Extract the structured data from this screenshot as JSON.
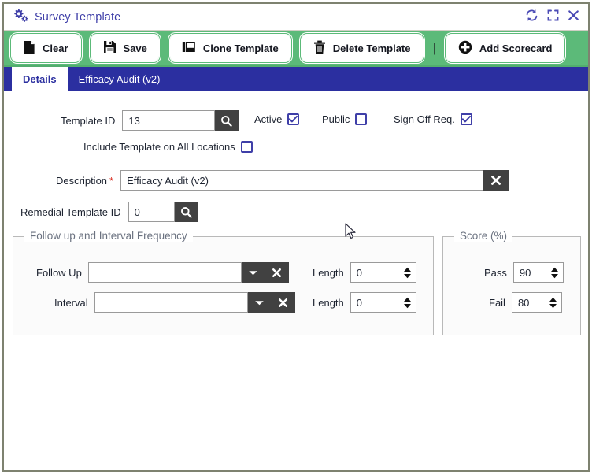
{
  "window": {
    "title": "Survey Template",
    "title_icon": "gears-icon",
    "controls": [
      {
        "name": "refresh-icon",
        "label": "Refresh"
      },
      {
        "name": "maximize-icon",
        "label": "Maximize"
      },
      {
        "name": "close-icon",
        "label": "Close"
      }
    ]
  },
  "toolbar": {
    "buttons": [
      {
        "name": "clear-button",
        "label": "Clear",
        "icon": "file-icon"
      },
      {
        "name": "save-button",
        "label": "Save",
        "icon": "floppy-disk-icon"
      },
      {
        "name": "clone-template-button",
        "label": "Clone Template",
        "icon": "copy-icon"
      },
      {
        "name": "delete-template-button",
        "label": "Delete Template",
        "icon": "trash-icon"
      }
    ],
    "separator": "|",
    "add_scorecard": {
      "name": "add-scorecard-button",
      "label": "Add Scorecard",
      "icon": "plus-circle-icon"
    }
  },
  "tabs": [
    {
      "label": "Details",
      "active": true
    },
    {
      "label": "Efficacy Audit (v2)",
      "active": false
    }
  ],
  "form": {
    "template_id": {
      "label": "Template ID",
      "value": "13",
      "search_icon": "search-icon"
    },
    "active": {
      "label": "Active",
      "checked": true
    },
    "public": {
      "label": "Public",
      "checked": false
    },
    "sign_off_req": {
      "label": "Sign Off Req.",
      "checked": true
    },
    "include_all_locations": {
      "label": "Include Template on All Locations",
      "checked": false
    },
    "description": {
      "label": "Description",
      "required_marker": "*",
      "value": "Efficacy Audit (v2)",
      "clear_icon": "close-x-icon"
    },
    "remedial_template_id": {
      "label": "Remedial Template ID",
      "value": "0",
      "search_icon": "search-icon"
    }
  },
  "follow_up_group": {
    "legend": "Follow up and Interval Frequency",
    "rows": [
      {
        "label": "Follow Up",
        "value": "",
        "placeholder": "",
        "length_label": "Length",
        "length_value": "0"
      },
      {
        "label": "Interval",
        "value": "",
        "placeholder": "",
        "length_label": "Length",
        "length_value": "0"
      }
    ]
  },
  "score_group": {
    "legend": "Score (%)",
    "pass": {
      "label": "Pass",
      "value": "90"
    },
    "fail": {
      "label": "Fail",
      "value": "80"
    }
  },
  "colors": {
    "toolbar_green": "#5cba79",
    "tabbar_blue": "#2b2fa0",
    "title_purple": "#3f3fa8",
    "dark_button": "#414141",
    "required_red": "#d93025",
    "window_border": "#7e8270"
  }
}
